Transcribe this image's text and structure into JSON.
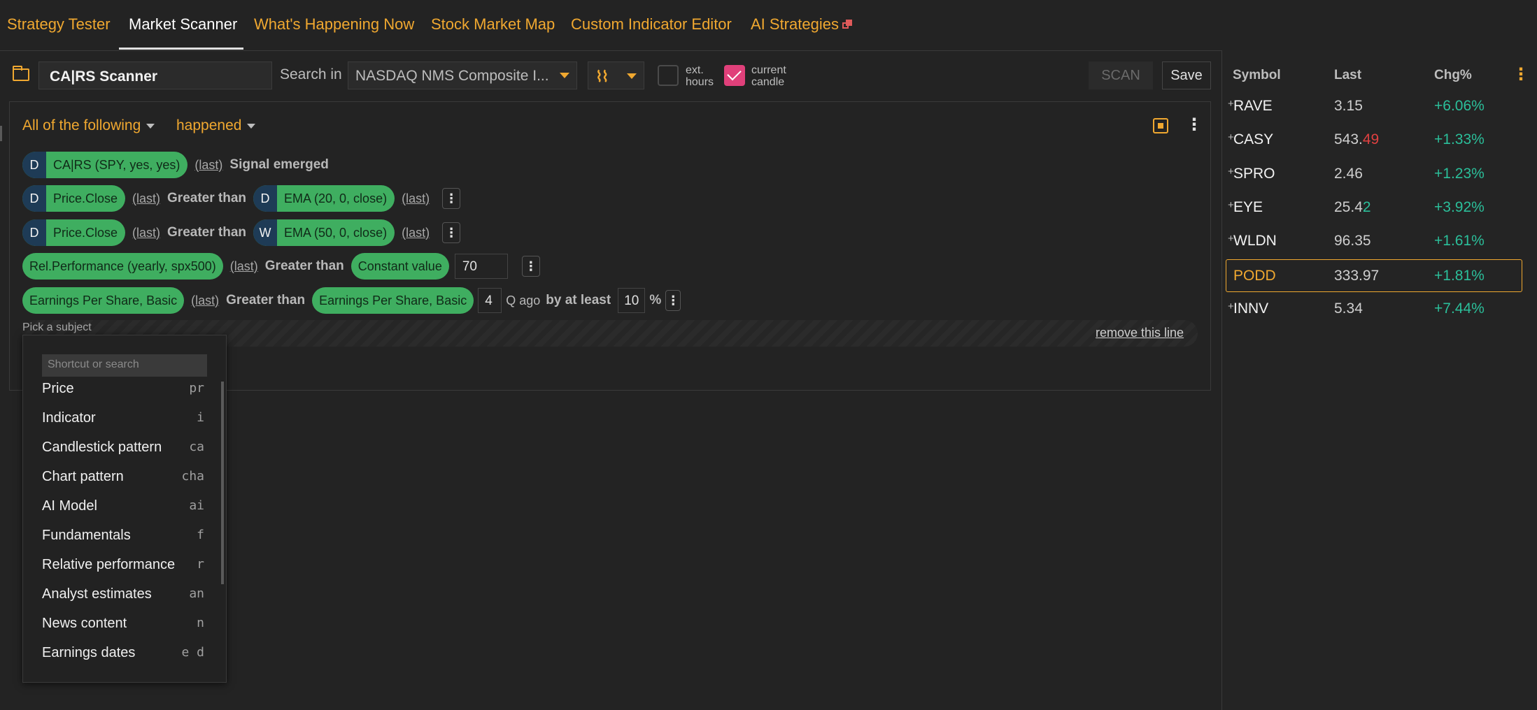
{
  "nav": {
    "tabs": [
      {
        "label": "Strategy Tester"
      },
      {
        "label": "Market Scanner"
      },
      {
        "label": "What's Happening Now"
      },
      {
        "label": "Stock Market Map"
      },
      {
        "label": "Custom Indicator Editor"
      },
      {
        "label": "AI Strategies"
      }
    ],
    "active_tab": "Market Scanner"
  },
  "toolbar": {
    "scanner_name": "CA|RS Scanner",
    "search_in_label": "Search in",
    "market": "NASDAQ NMS Composite I...",
    "interval_glyph": "⌇⌇",
    "ext_hours_label_1": "ext.",
    "ext_hours_label_2": "hours",
    "ext_hours_checked": false,
    "current_candle_label_1": "current",
    "current_candle_label_2": "candle",
    "current_candle_checked": true,
    "scan_label": "SCAN",
    "save_label": "Save"
  },
  "conditions": {
    "match_mode": "All of the following",
    "event_mode": "happened",
    "rows": [
      {
        "tf": "D",
        "subject": "CA|RS (SPY, yes, yes)",
        "last": "(last)",
        "op": "Signal emerged"
      },
      {
        "tf": "D",
        "subject": "Price.Close",
        "last": "(last)",
        "op": "Greater than",
        "tf2": "D",
        "target": "EMA (20, 0, close)",
        "last2": "(last)"
      },
      {
        "tf": "D",
        "subject": "Price.Close",
        "last": "(last)",
        "op": "Greater than",
        "tf2": "W",
        "target": "EMA (50, 0, close)",
        "last2": "(last)"
      },
      {
        "subject": "Rel.Performance (yearly, spx500)",
        "last": "(last)",
        "op": "Greater than",
        "target": "Constant value",
        "value": "70"
      },
      {
        "subject": "Earnings Per Share, Basic",
        "last": "(last)",
        "op": "Greater than",
        "target": "Earnings Per Share, Basic",
        "value": "4",
        "q_ago": "Q ago",
        "by_at_least": "by at least",
        "value2": "10",
        "pct": "%"
      }
    ],
    "pick_subject": "Pick a subject",
    "remove_line": "remove this line"
  },
  "subject_dropdown": {
    "search_placeholder": "Shortcut or search",
    "items": [
      {
        "label": "Price",
        "shortcut": "pr"
      },
      {
        "label": "Indicator",
        "shortcut": "i"
      },
      {
        "label": "Candlestick pattern",
        "shortcut": "ca"
      },
      {
        "label": "Chart pattern",
        "shortcut": "cha"
      },
      {
        "label": "AI Model",
        "shortcut": "ai"
      },
      {
        "label": "Fundamentals",
        "shortcut": "f"
      },
      {
        "label": "Relative performance",
        "shortcut": "r"
      },
      {
        "label": "Analyst estimates",
        "shortcut": "an"
      },
      {
        "label": "News content",
        "shortcut": "n"
      },
      {
        "label": "Earnings dates",
        "shortcut": "e d"
      }
    ]
  },
  "watchlist": {
    "headers": {
      "symbol": "Symbol",
      "last": "Last",
      "chg": "Chg%"
    },
    "rows": [
      {
        "plus": "+",
        "symbol": "RAVE",
        "last": "3.15",
        "last_tail": "",
        "chg": "+6.06%"
      },
      {
        "plus": "+",
        "symbol": "CASY",
        "last": "543.",
        "last_tail": "49",
        "tail_color": "#e04040",
        "chg": "+1.33%"
      },
      {
        "plus": "+",
        "symbol": "SPRO",
        "last": "2.46",
        "last_tail": "",
        "chg": "+1.23%"
      },
      {
        "plus": "+",
        "symbol": "EYE",
        "last": "25.4",
        "last_tail": "2",
        "tail_color": "#2bbf9a",
        "chg": "+3.92%"
      },
      {
        "plus": "+",
        "symbol": "WLDN",
        "last": "96.35",
        "last_tail": "",
        "chg": "+1.61%"
      },
      {
        "plus": "",
        "symbol": "PODD",
        "last": "333.97",
        "last_tail": "",
        "chg": "+1.81%",
        "selected": true
      },
      {
        "plus": "+",
        "symbol": "INNV",
        "last": "5.34",
        "last_tail": "",
        "chg": "+7.44%"
      }
    ]
  },
  "colors": {
    "accent": "#f0a830",
    "pill_green": "#3fae60",
    "positive": "#2bbf9a",
    "negative": "#e04040",
    "checkbox_on": "#e0407a"
  },
  "icons": [
    "folder-icon",
    "external-link-icon",
    "chip-icon",
    "kebab-menu-icon",
    "interval-icon"
  ]
}
